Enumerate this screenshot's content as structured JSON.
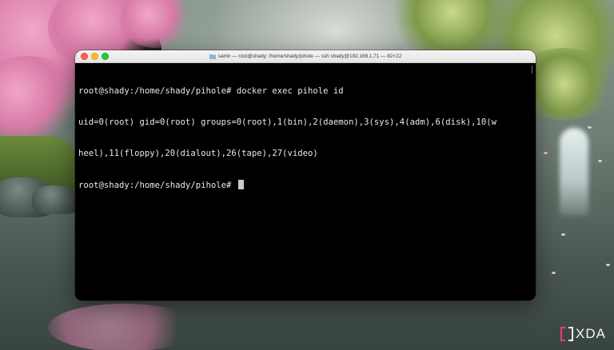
{
  "window": {
    "title": "samir — root@shady: /home/shady/pihole — ssh shady@192.168.1.71 — 82×22",
    "traffic_lights": [
      "close",
      "minimize",
      "zoom"
    ],
    "title_icon": "folder-icon"
  },
  "terminal": {
    "lines": [
      "root@shady:/home/shady/pihole# docker exec pihole id",
      "uid=0(root) gid=0(root) groups=0(root),1(bin),2(daemon),3(sys),4(adm),6(disk),10(w",
      "heel),11(floppy),20(dialout),26(tape),27(video)"
    ],
    "prompt": "root@shady:/home/shady/pihole# ",
    "colors": {
      "background": "#000000",
      "foreground": "#e8e8e8",
      "cursor": "#c8c8c8"
    }
  },
  "watermark": {
    "text": "XDA",
    "icon": "xda-logo-icon"
  }
}
